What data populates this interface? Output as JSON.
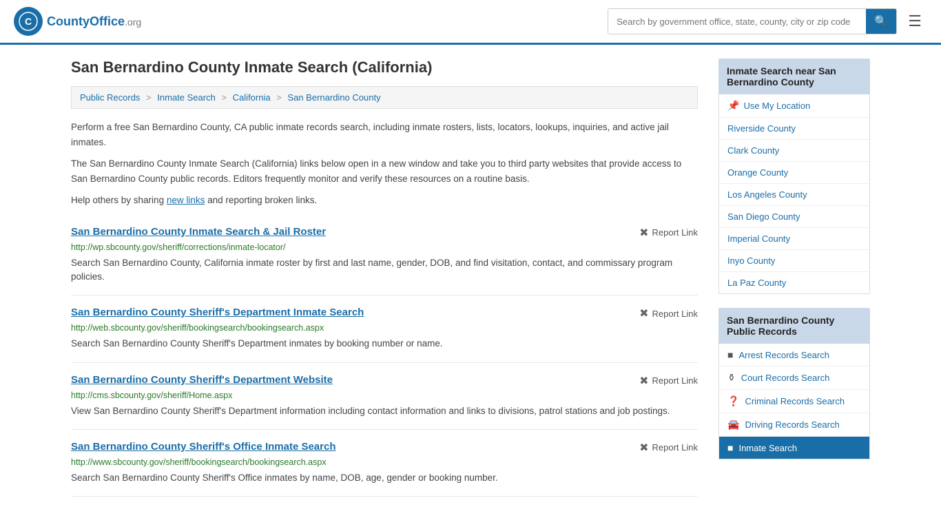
{
  "header": {
    "logo_text": "CountyOffice",
    "logo_suffix": ".org",
    "search_placeholder": "Search by government office, state, county, city or zip code"
  },
  "page": {
    "title": "San Bernardino County Inmate Search (California)",
    "breadcrumb": [
      {
        "label": "Public Records",
        "href": "#"
      },
      {
        "label": "Inmate Search",
        "href": "#"
      },
      {
        "label": "California",
        "href": "#"
      },
      {
        "label": "San Bernardino County",
        "href": "#"
      }
    ],
    "description1": "Perform a free San Bernardino County, CA public inmate records search, including inmate rosters, lists, locators, lookups, inquiries, and active jail inmates.",
    "description2": "The San Bernardino County Inmate Search (California) links below open in a new window and take you to third party websites that provide access to San Bernardino County public records. Editors frequently monitor and verify these resources on a routine basis.",
    "description3_pre": "Help others by sharing ",
    "description3_link": "new links",
    "description3_post": " and reporting broken links."
  },
  "results": [
    {
      "title": "San Bernardino County Inmate Search & Jail Roster",
      "report_label": "Report Link",
      "url": "http://wp.sbcounty.gov/sheriff/corrections/inmate-locator/",
      "description": "Search San Bernardino County, California inmate roster by first and last name, gender, DOB, and find visitation, contact, and commissary program policies."
    },
    {
      "title": "San Bernardino County Sheriff's Department Inmate Search",
      "report_label": "Report Link",
      "url": "http://web.sbcounty.gov/sheriff/bookingsearch/bookingsearch.aspx",
      "description": "Search San Bernardino County Sheriff's Department inmates by booking number or name."
    },
    {
      "title": "San Bernardino County Sheriff's Department Website",
      "report_label": "Report Link",
      "url": "http://cms.sbcounty.gov/sheriff/Home.aspx",
      "description": "View San Bernardino County Sheriff's Department information including contact information and links to divisions, patrol stations and job postings."
    },
    {
      "title": "San Bernardino County Sheriff's Office Inmate Search",
      "report_label": "Report Link",
      "url": "http://www.sbcounty.gov/sheriff/bookingsearch/bookingsearch.aspx",
      "description": "Search San Bernardino County Sheriff's Office inmates by name, DOB, age, gender or booking number."
    }
  ],
  "sidebar": {
    "nearby_header": "Inmate Search near San Bernardino County",
    "use_location_label": "Use My Location",
    "nearby_counties": [
      "Riverside County",
      "Clark County",
      "Orange County",
      "Los Angeles County",
      "San Diego County",
      "Imperial County",
      "Inyo County",
      "La Paz County"
    ],
    "public_records_header": "San Bernardino County Public Records",
    "public_records": [
      {
        "label": "Arrest Records Search",
        "icon": "square",
        "active": false
      },
      {
        "label": "Court Records Search",
        "icon": "columns",
        "active": false
      },
      {
        "label": "Criminal Records Search",
        "icon": "exclaim",
        "active": false
      },
      {
        "label": "Driving Records Search",
        "icon": "car",
        "active": false
      },
      {
        "label": "Inmate Search",
        "icon": "person",
        "active": true
      }
    ]
  }
}
